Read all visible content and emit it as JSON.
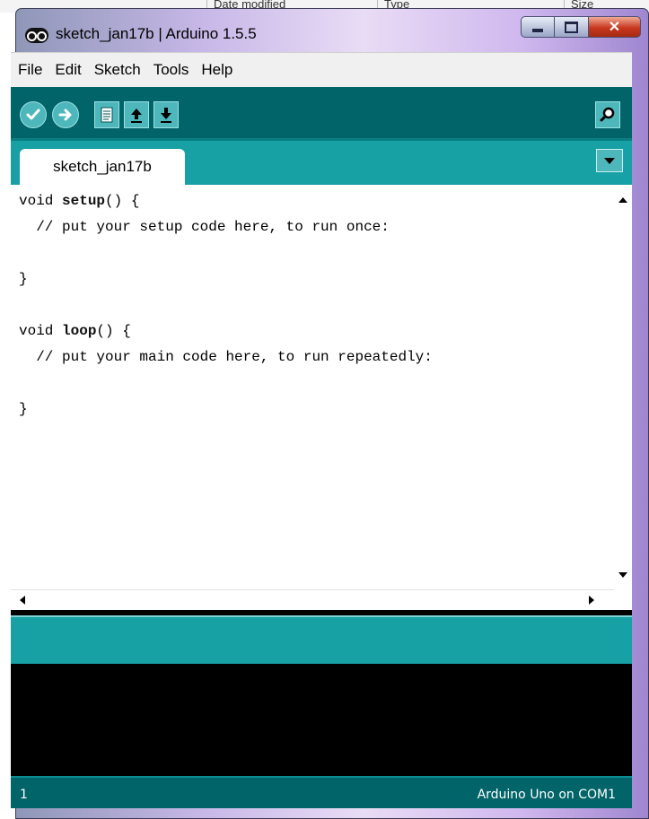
{
  "background_window": {
    "columns": [
      "Date modified",
      "Type",
      "Size"
    ]
  },
  "window": {
    "title": "sketch_jan17b | Arduino 1.5.5",
    "app_icon": "arduino-logo-icon",
    "controls": {
      "minimize": "minimize-icon",
      "maximize": "maximize-icon",
      "close": "close-icon"
    }
  },
  "menubar": {
    "items": [
      "File",
      "Edit",
      "Sketch",
      "Tools",
      "Help"
    ]
  },
  "toolbar": {
    "buttons": [
      {
        "name": "verify",
        "icon": "checkmark-icon"
      },
      {
        "name": "upload",
        "icon": "arrow-right-icon"
      },
      {
        "name": "new",
        "icon": "document-icon"
      },
      {
        "name": "open",
        "icon": "arrow-up-icon"
      },
      {
        "name": "save",
        "icon": "arrow-down-icon"
      },
      {
        "name": "serial-monitor",
        "icon": "magnifier-icon"
      }
    ]
  },
  "tabs": {
    "active": "sketch_jan17b",
    "menu_icon": "chevron-down-icon"
  },
  "editor": {
    "lines": [
      {
        "pre": "void ",
        "kw": "setup",
        "post": "() {"
      },
      {
        "pre": "  // put your setup code here, to run once:",
        "kw": "",
        "post": ""
      },
      {
        "pre": "",
        "kw": "",
        "post": ""
      },
      {
        "pre": "}",
        "kw": "",
        "post": ""
      },
      {
        "pre": "",
        "kw": "",
        "post": ""
      },
      {
        "pre": "void ",
        "kw": "loop",
        "post": "() {"
      },
      {
        "pre": "  // put your main code here, to run repeatedly:",
        "kw": "",
        "post": ""
      },
      {
        "pre": "",
        "kw": "",
        "post": ""
      },
      {
        "pre": "}",
        "kw": "",
        "post": ""
      }
    ]
  },
  "status": {
    "line_number": "1",
    "board": "Arduino Uno on COM1"
  },
  "colors": {
    "toolbar": "#006468",
    "tabbar": "#17a1a5",
    "button": "#4db7bb",
    "console": "#000000"
  }
}
